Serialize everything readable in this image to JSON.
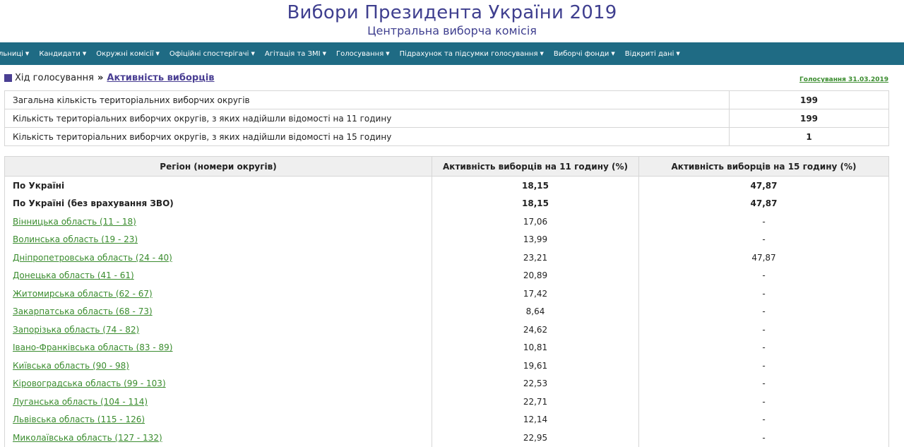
{
  "header": {
    "title": "Вибори Президента України 2019",
    "subtitle": "Центральна виборча комісія"
  },
  "nav": [
    "льниці",
    "Кандидати",
    "Окружні комісії",
    "Офіційні спостерігачі",
    "Агітація та ЗМІ",
    "Голосування",
    "Підрахунок та підсумки голосування",
    "Виборчі фонди",
    "Відкриті дані"
  ],
  "breadcrumb": {
    "parent": "Хід голосування",
    "separator": "»",
    "current": "Активність виборців",
    "date_link": "Голосування 31.03.2019"
  },
  "summary": [
    {
      "label": "Загальна кількість територіальних виборчих округів",
      "value": "199"
    },
    {
      "label": "Кількість територіальних виборчих округів, з яких надійшли відомості на 11 годину",
      "value": "199"
    },
    {
      "label": "Кількість територіальних виборчих округів, з яких надійшли відомості на 15 годину",
      "value": "1"
    }
  ],
  "table": {
    "headers": [
      "Регіон (номери округів)",
      "Активність виборців на 11 годину (%)",
      "Активність виборців на 15 годину (%)"
    ],
    "totals": [
      {
        "region": "По Україні",
        "h11": "18,15",
        "h15": "47,87"
      },
      {
        "region": "По Україні (без врахування ЗВО)",
        "h11": "18,15",
        "h15": "47,87"
      }
    ],
    "rows": [
      {
        "region": "Вінницька область (11 - 18)",
        "h11": "17,06",
        "h15": "-"
      },
      {
        "region": "Волинська область (19 - 23)",
        "h11": "13,99",
        "h15": "-"
      },
      {
        "region": "Дніпропетровська область (24 - 40)",
        "h11": "23,21",
        "h15": "47,87"
      },
      {
        "region": "Донецька область (41 - 61)",
        "h11": "20,89",
        "h15": "-"
      },
      {
        "region": "Житомирська область (62 - 67)",
        "h11": "17,42",
        "h15": "-"
      },
      {
        "region": "Закарпатська область (68 - 73)",
        "h11": "8,64",
        "h15": "-"
      },
      {
        "region": "Запорізька область (74 - 82)",
        "h11": "24,62",
        "h15": "-"
      },
      {
        "region": "Івано-Франківська область (83 - 89)",
        "h11": "10,81",
        "h15": "-"
      },
      {
        "region": "Київська область (90 - 98)",
        "h11": "19,61",
        "h15": "-"
      },
      {
        "region": "Кіровоградська область (99 - 103)",
        "h11": "22,53",
        "h15": "-"
      },
      {
        "region": "Луганська область (104 - 114)",
        "h11": "22,71",
        "h15": "-"
      },
      {
        "region": "Львівська область (115 - 126)",
        "h11": "12,14",
        "h15": "-"
      },
      {
        "region": "Миколаївська область (127 - 132)",
        "h11": "22,95",
        "h15": "-"
      }
    ]
  },
  "colors": {
    "navbar": "#1f6b84",
    "title": "#3f3f8f",
    "link_green": "#3a8c2e",
    "accent_purple": "#4a3f93"
  }
}
